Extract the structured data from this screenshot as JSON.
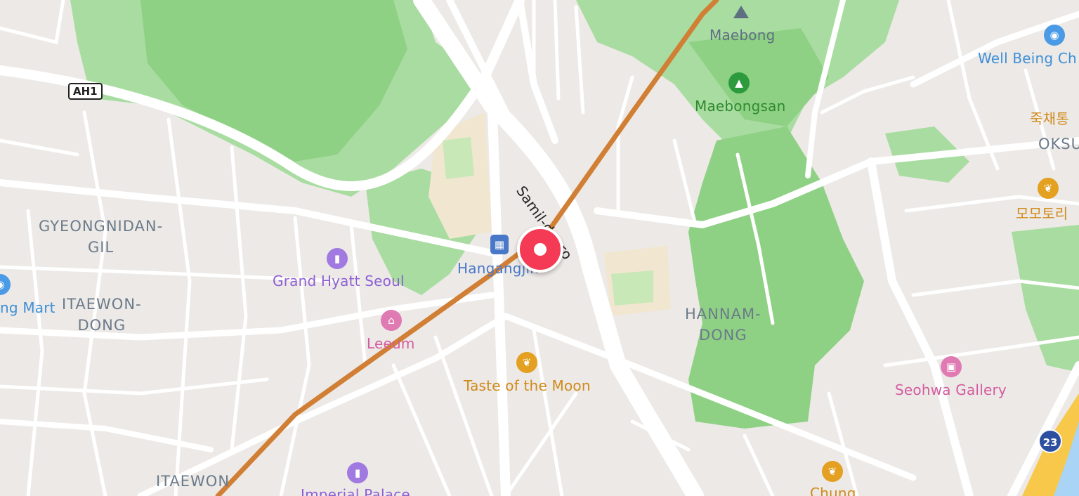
{
  "colors": {
    "background": "#ece9e6",
    "park": "#a8dca0",
    "forest": "#8fd184",
    "road": "#ffffff",
    "route_line": "#d17f34",
    "marker": "#f43a54",
    "water": "#f7c84a"
  },
  "districts": {
    "gyeongnidan_line1": "GYEONGNIDAN-",
    "gyeongnidan_line2": "GIL",
    "itaewon_dong_line1": "ITAEWON-",
    "itaewon_dong_line2": "DONG",
    "hannam_line1": "HANNAM-",
    "hannam_line2": "DONG",
    "itaewon": "ITAEWON",
    "oksu": "OKSU"
  },
  "pois": {
    "grand_hyatt": "Grand Hyatt Seoul",
    "leeum": "Leeum",
    "taste_of_the_moon": "Taste of the Moon",
    "seohwa_gallery": "Seohwa Gallery",
    "maebong": "Maebong",
    "maebongsan": "Maebongsan",
    "well_being": "Well Being Ch",
    "mart": "ng Mart",
    "hangangjin": "Hangangjin",
    "imperial_palace": "Imperial Palace",
    "chung": "Chung",
    "korean_1": "죽채통",
    "korean_2": "모모토리"
  },
  "roads": {
    "samil_daero": "Samil-daero",
    "ah1": "AH1",
    "route_23": "23"
  },
  "icons": {
    "hotel": "hotel-icon",
    "food": "restaurant-icon",
    "museum": "museum-icon",
    "park": "park-icon",
    "shop": "shopping-icon",
    "station": "subway-station-icon",
    "peak": "mountain-peak-icon",
    "marker": "location-pin-icon"
  }
}
